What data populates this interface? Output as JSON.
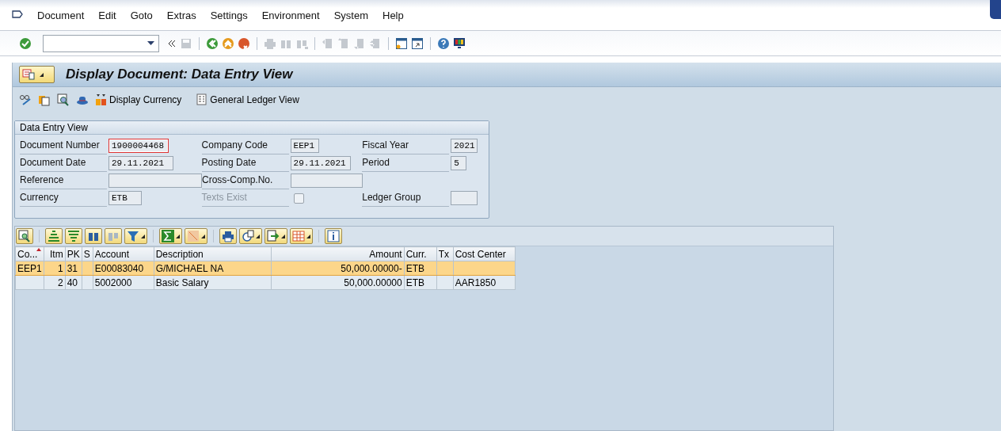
{
  "menu": [
    {
      "label": "Document"
    },
    {
      "label": "Edit"
    },
    {
      "label": "Goto"
    },
    {
      "label": "Extras"
    },
    {
      "label": "Settings"
    },
    {
      "label": "Environment"
    },
    {
      "label": "System"
    },
    {
      "label": "Help"
    }
  ],
  "title": "Display Document: Data Entry View",
  "app_toolbar": [
    {
      "label": "Display Currency"
    },
    {
      "label": "General Ledger View"
    }
  ],
  "group": {
    "title": "Data Entry View",
    "rows": [
      [
        {
          "kind": "field",
          "label": "Document Number",
          "value": "1900004468",
          "focused": true,
          "disabled": false
        },
        {
          "kind": "field",
          "label": "Company Code",
          "value": "EEP1",
          "focused": false,
          "disabled": false
        },
        {
          "kind": "field",
          "label": "Fiscal Year",
          "value": "2021",
          "focused": false,
          "disabled": false
        }
      ],
      [
        {
          "kind": "field",
          "label": "Document Date",
          "value": "29.11.2021",
          "focused": false,
          "disabled": false
        },
        {
          "kind": "field",
          "label": "Posting Date",
          "value": "29.11.2021",
          "focused": false,
          "disabled": false
        },
        {
          "kind": "field",
          "label": "Period",
          "value": "5",
          "focused": false,
          "disabled": false
        }
      ],
      [
        {
          "kind": "field",
          "label": "Reference",
          "focused": false,
          "disabled": false
        },
        {
          "kind": "field",
          "label": "Cross-Comp.No.",
          "focused": false,
          "disabled": false
        }
      ],
      [
        {
          "kind": "field",
          "label": "Currency",
          "value": "ETB",
          "focused": false,
          "disabled": false
        },
        {
          "kind": "checkbox",
          "label": "Texts Exist",
          "checked": false,
          "disabled": true
        },
        {
          "kind": "field",
          "label": "Ledger Group",
          "focused": false,
          "disabled": false
        }
      ]
    ]
  },
  "table": {
    "columns": [
      {
        "label": "Co...",
        "sorted": true
      },
      {
        "label": "Itm",
        "sorted": false
      },
      {
        "label": "PK",
        "sorted": false
      },
      {
        "label": "S",
        "sorted": false
      },
      {
        "label": "Account",
        "sorted": false
      },
      {
        "label": "Description",
        "sorted": false
      },
      {
        "label": "Amount",
        "sorted": false
      },
      {
        "label": "Curr.",
        "sorted": false
      },
      {
        "label": "Tx",
        "sorted": false
      },
      {
        "label": "Cost Center",
        "sorted": false
      }
    ],
    "rows": [
      {
        "selected": true,
        "cells": [
          "EEP1",
          "1",
          "31",
          null,
          "E00083040",
          "G/MICHAEL NA",
          "50,000.00000-",
          "ETB",
          null,
          null
        ]
      },
      {
        "selected": false,
        "cells": [
          null,
          "2",
          "40",
          null,
          "5002000",
          "Basic Salary",
          "50,000.00000",
          "ETB",
          null,
          "AAR1850"
        ]
      }
    ]
  }
}
